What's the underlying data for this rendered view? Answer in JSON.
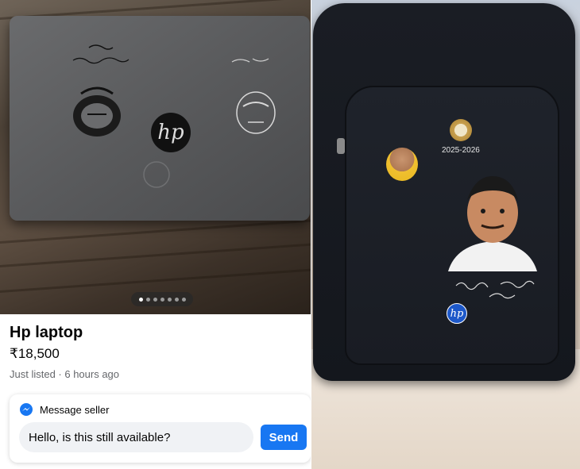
{
  "listing": {
    "title": "Hp laptop",
    "price": "₹18,500",
    "meta": "Just listed · 6 hours ago"
  },
  "carousel": {
    "total": 7,
    "active_index": 0
  },
  "message": {
    "header_label": "Message seller",
    "input_value": "Hello, is this still available?",
    "send_label": "Send"
  },
  "laptop_photo": {
    "logo_text": "hp"
  },
  "bag_photo": {
    "year_text": "2025-2026",
    "logo_text": "hp"
  },
  "colors": {
    "accent": "#1877f2",
    "text_primary": "#050505",
    "text_secondary": "#65676b",
    "input_bg": "#f0f2f5"
  },
  "icons": {
    "messenger": "messenger-icon"
  }
}
